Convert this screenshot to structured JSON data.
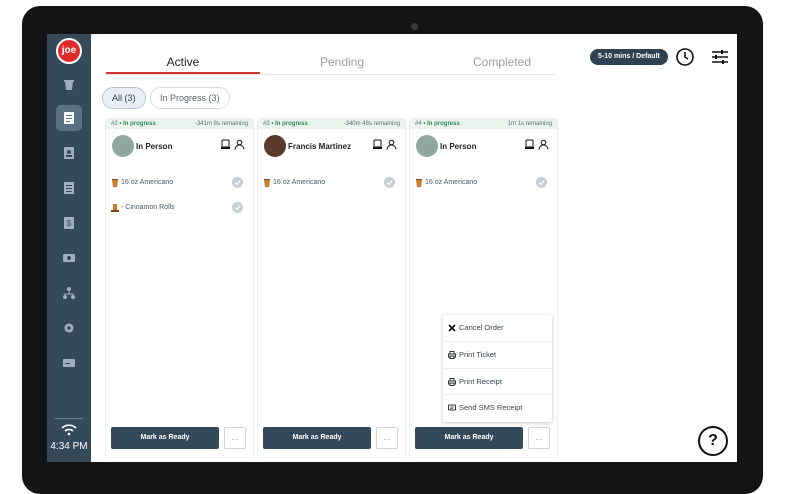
{
  "app": {
    "logo_text": "joe"
  },
  "sidebar": {
    "items": [
      {
        "icon": "cup-icon",
        "active": false
      },
      {
        "icon": "orders-icon",
        "active": true
      },
      {
        "icon": "contact-icon",
        "active": false
      },
      {
        "icon": "list-icon",
        "active": false
      },
      {
        "icon": "dollar-icon",
        "active": false
      },
      {
        "icon": "cash-icon",
        "active": false
      },
      {
        "icon": "hierarchy-icon",
        "active": false
      },
      {
        "icon": "gear-icon",
        "active": false
      },
      {
        "icon": "card-icon",
        "active": false
      }
    ],
    "time": "4:34 PM"
  },
  "tabs": [
    {
      "label": "Active",
      "active": true
    },
    {
      "label": "Pending",
      "active": false
    },
    {
      "label": "Completed",
      "active": false
    }
  ],
  "header": {
    "eta_badge": "5-10 mins / Default"
  },
  "filters": [
    {
      "label": "All (3)",
      "active": true
    },
    {
      "label": "In Progress (3)",
      "active": false
    }
  ],
  "orders": [
    {
      "number": "#2",
      "status": "• In progress",
      "remaining": "-341m 8s remaining",
      "customer": "In Person",
      "items": [
        "16 oz Americano",
        "- Cinnamon Rolls"
      ],
      "ready_label": "Mark as Ready",
      "more_label": "..."
    },
    {
      "number": "#3",
      "status": "• In progress",
      "remaining": "-340m 48s remaining",
      "customer": "Francis Martinez",
      "items": [
        "16 oz Americano"
      ],
      "ready_label": "Mark as Ready",
      "more_label": "..."
    },
    {
      "number": "#4",
      "status": "• In progress",
      "remaining": "1m 1s remaining",
      "customer": "In Person",
      "items": [
        "16 oz Americano"
      ],
      "ready_label": "Mark as Ready",
      "more_label": "..."
    }
  ],
  "menu": {
    "items": [
      {
        "label": "Cancel Order",
        "icon": "close-icon"
      },
      {
        "label": "Print Ticket",
        "icon": "printer-icon"
      },
      {
        "label": "Print Receipt",
        "icon": "printer-icon"
      },
      {
        "label": "Send SMS Receipt",
        "icon": "sms-icon"
      }
    ]
  },
  "help": {
    "label": "?"
  },
  "colors": {
    "accent": "#d32f2f",
    "sidebar": "#34495a",
    "status_green": "#2e8b57"
  }
}
